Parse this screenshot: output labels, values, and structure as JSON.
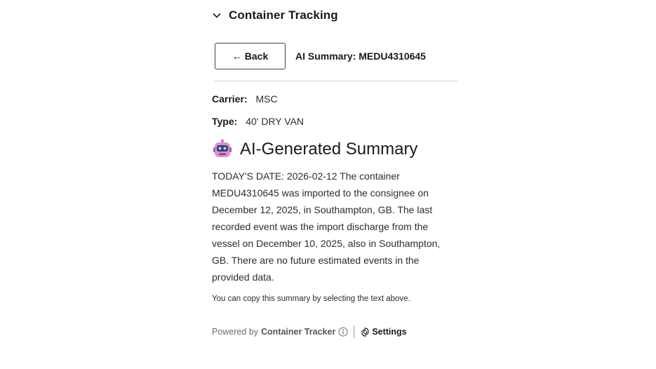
{
  "section": {
    "title": "Container Tracking",
    "icon": "chevron-down-icon"
  },
  "toolbar": {
    "back_label": "Back",
    "back_arrow": "←",
    "summary_heading": "AI Summary: MEDU4310645"
  },
  "details": {
    "carrier_label": "Carrier:",
    "carrier_value": "MSC",
    "type_label": "Type:",
    "type_value": "40' DRY VAN"
  },
  "ai_summary": {
    "title": "AI-Generated Summary",
    "icon": "robot-icon",
    "text": "TODAY'S DATE: 2026-02-12 The container MEDU4310645 was imported to the consignee on December 12, 2025, in Southampton, GB. The last recorded event was the import discharge from the vessel on December 10, 2025, also in Southampton, GB. There are no future estimated events in the provided data.",
    "copy_hint": "You can copy this summary by selecting the text above."
  },
  "footer": {
    "powered_by": "Powered by",
    "brand": "Container Tracker",
    "info_icon": "info-icon",
    "settings_label": "Settings",
    "settings_icon": "gear-icon"
  }
}
